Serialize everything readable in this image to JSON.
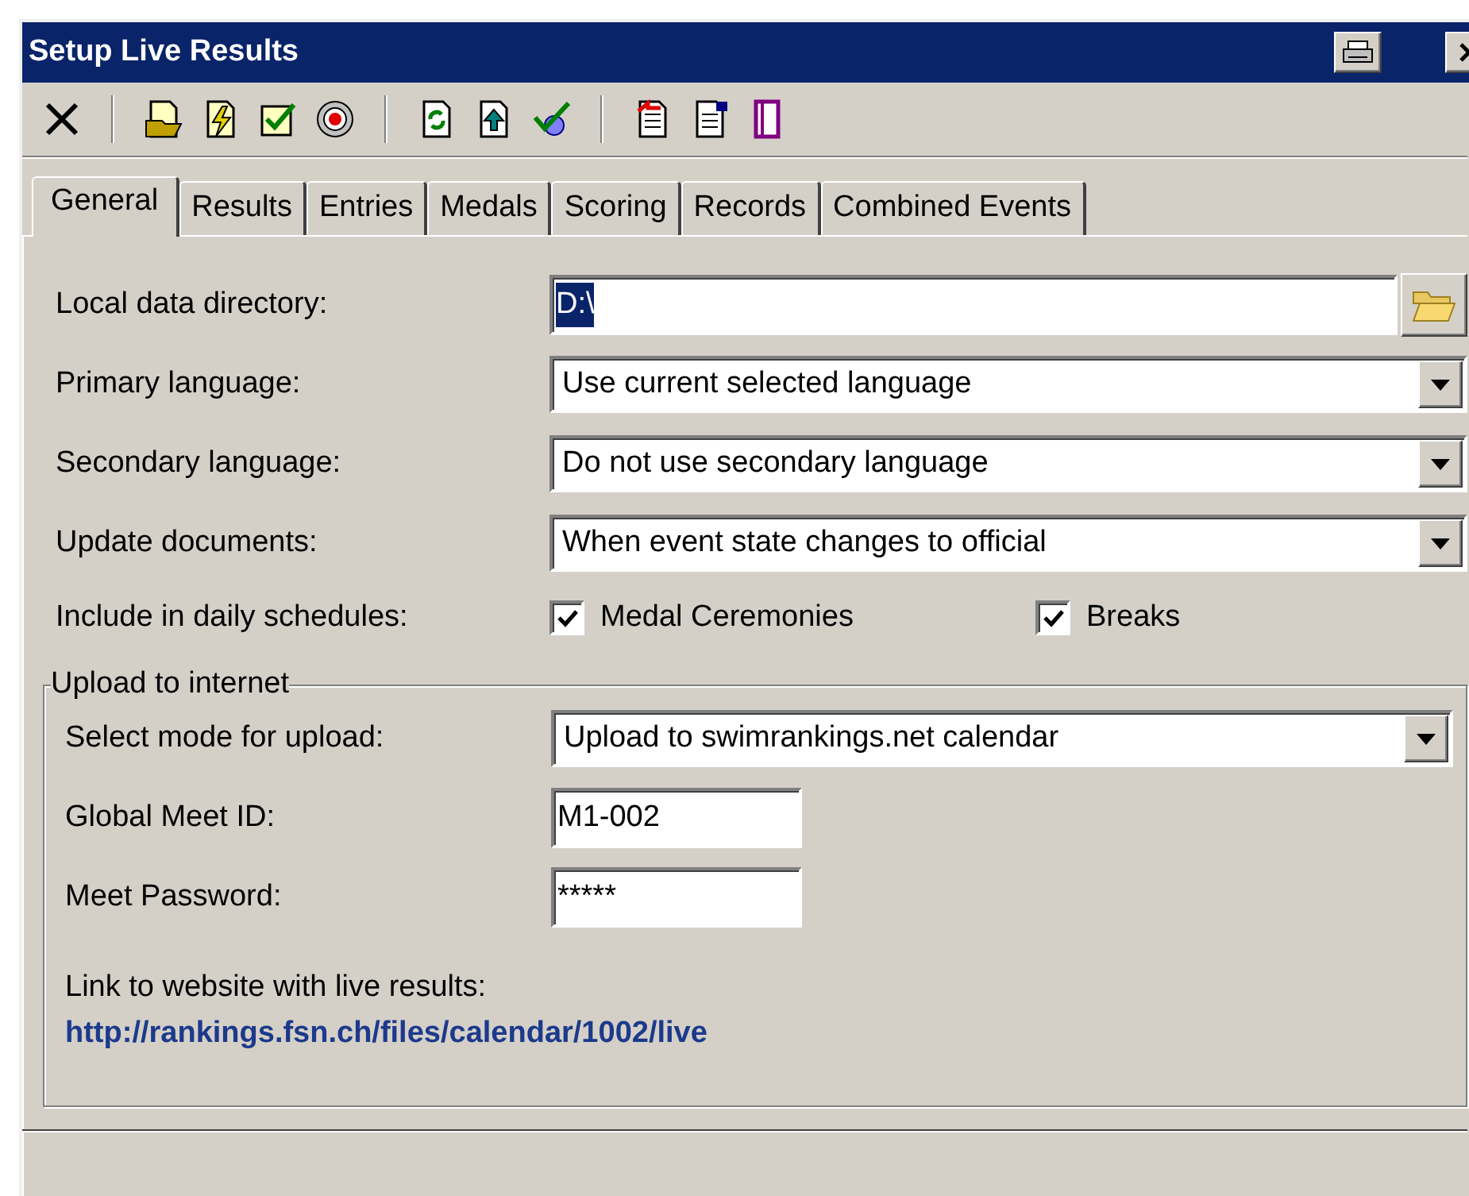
{
  "window": {
    "title": "Setup Live Results"
  },
  "tabs": [
    {
      "label": "General",
      "selected": true
    },
    {
      "label": "Results",
      "selected": false
    },
    {
      "label": "Entries",
      "selected": false
    },
    {
      "label": "Medals",
      "selected": false
    },
    {
      "label": "Scoring",
      "selected": false
    },
    {
      "label": "Records",
      "selected": false
    },
    {
      "label": "Combined Events",
      "selected": false
    }
  ],
  "fields": [
    {
      "kind": "path",
      "label": "Local data directory:",
      "value": "D:\\",
      "text_selected": true
    },
    {
      "kind": "dropdown",
      "label": "Primary language:",
      "value": "Use current selected language"
    },
    {
      "kind": "dropdown",
      "label": "Secondary language:",
      "value": "Do not use secondary language"
    },
    {
      "kind": "dropdown",
      "label": "Update documents:",
      "value": "When event state changes to official"
    }
  ],
  "schedules": {
    "label": "Include in daily schedules:",
    "options": [
      {
        "label": "Medal Ceremonies",
        "checked": true
      },
      {
        "label": "Breaks",
        "checked": true
      }
    ]
  },
  "upload": {
    "title": "Upload to internet",
    "mode": {
      "label": "Select mode for upload:",
      "value": "Upload to swimrankings.net calendar"
    },
    "meet_id": {
      "label": "Global Meet ID:",
      "value": "M1-002"
    },
    "password": {
      "label": "Meet Password:",
      "value": "*****"
    },
    "link_label": "Link to website with live results:",
    "link": "http://rankings.fsn.ch/files/calendar/1002/live"
  }
}
